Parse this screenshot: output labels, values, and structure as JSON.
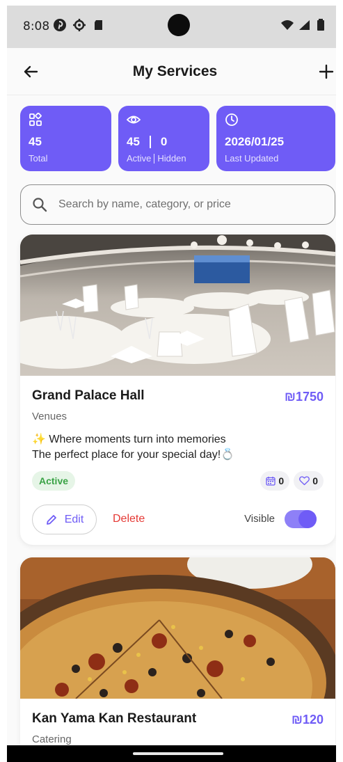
{
  "status_bar": {
    "time": "8:08",
    "left_icons": [
      "pinterest-icon",
      "settings-icon",
      "sd-card-icon"
    ],
    "right_icons": [
      "wifi-icon",
      "signal-icon",
      "battery-icon"
    ]
  },
  "app_bar": {
    "title": "My Services",
    "back_icon": "arrow-left-icon",
    "add_icon": "plus-icon"
  },
  "stats": {
    "total": {
      "value": "45",
      "label": "Total",
      "icon": "grid-icon"
    },
    "visibility": {
      "active_value": "45",
      "hidden_value": "0",
      "active_label": "Active",
      "hidden_label": "Hidden",
      "icon": "eye-icon"
    },
    "updated": {
      "value": "2026/01/25",
      "label": "Last Updated",
      "icon": "clock-icon"
    }
  },
  "search": {
    "placeholder": "Search by name, category, or price",
    "value": ""
  },
  "services": [
    {
      "title": "Grand Palace Hall",
      "price": "₪1750",
      "category": "Venues",
      "description_line1": "✨ Where moments turn into memories",
      "description_line2": "The perfect place for your special day!💍",
      "status": "Active",
      "bookings": "0",
      "likes": "0",
      "edit_label": "Edit",
      "delete_label": "Delete",
      "visible_label": "Visible",
      "visible": true
    },
    {
      "title": "Kan Yama Kan Restaurant",
      "price": "₪120",
      "category": "Catering"
    }
  ],
  "colors": {
    "accent": "#6f5cf6",
    "active_green": "#3aa346",
    "delete_red": "#e53935"
  }
}
